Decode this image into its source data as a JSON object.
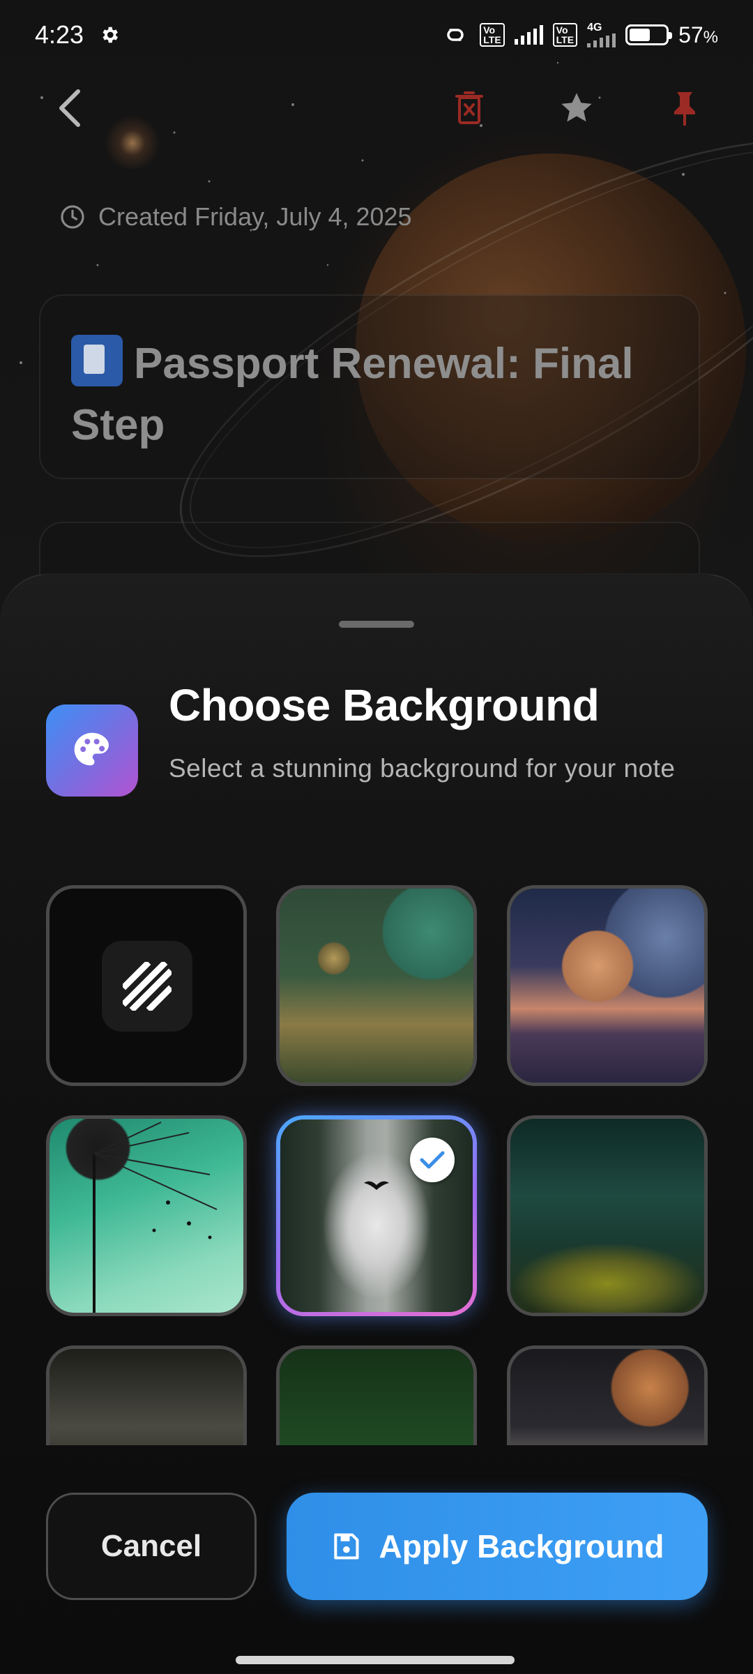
{
  "status_bar": {
    "time": "4:23",
    "battery": "57",
    "battery_unit": "%",
    "network": "4G",
    "volte": "Vo\nLTE"
  },
  "note": {
    "created": "Created Friday, July 4, 2025",
    "title": "Passport Renewal: Final Step"
  },
  "sheet": {
    "title": "Choose Background",
    "subtitle": "Select a stunning background for your note",
    "selected_index": 4,
    "backgrounds": [
      {
        "id": "none"
      },
      {
        "id": "green-planet-meadow"
      },
      {
        "id": "saturn-clouds"
      },
      {
        "id": "dandelion"
      },
      {
        "id": "misty-forest"
      },
      {
        "id": "forest-glade"
      },
      {
        "id": "mountains"
      },
      {
        "id": "green-tree"
      },
      {
        "id": "saturn-landscape"
      }
    ],
    "cancel_label": "Cancel",
    "apply_label": "Apply Background"
  },
  "colors": {
    "accent": "#3e9ff5",
    "accent_gradient_end": "#b353cf",
    "danger": "#c0392b"
  },
  "icons": [
    "back-icon",
    "delete-icon",
    "star-icon",
    "pin-icon",
    "clock-icon",
    "palette-icon",
    "save-icon",
    "check-icon",
    "no-background-icon"
  ]
}
